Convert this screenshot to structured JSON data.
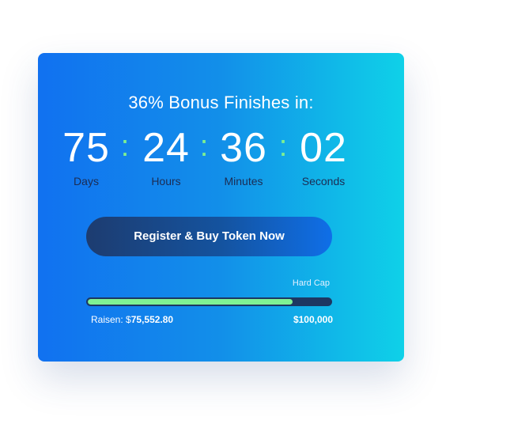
{
  "countdown": {
    "headline": "36% Bonus Finishes in:",
    "separator": ":",
    "days": {
      "value": "75",
      "label": "Days"
    },
    "hours": {
      "value": "24",
      "label": "Hours"
    },
    "minutes": {
      "value": "36",
      "label": "Minutes"
    },
    "seconds": {
      "value": "02",
      "label": "Seconds"
    }
  },
  "cta": {
    "label": "Register & Buy Token Now"
  },
  "sale": {
    "hard_cap_label": "Hard Cap",
    "raised_label": "Raisen: ",
    "raised_currency": "$",
    "raised_value": "75,552.80",
    "goal_value": "$100,000",
    "progress_fraction": 0.845
  },
  "colors": {
    "accent_green": "#7ff294",
    "gradient_start": "#1171f0",
    "gradient_end": "#0fd1e8",
    "button_dark": "#1d3c70"
  }
}
